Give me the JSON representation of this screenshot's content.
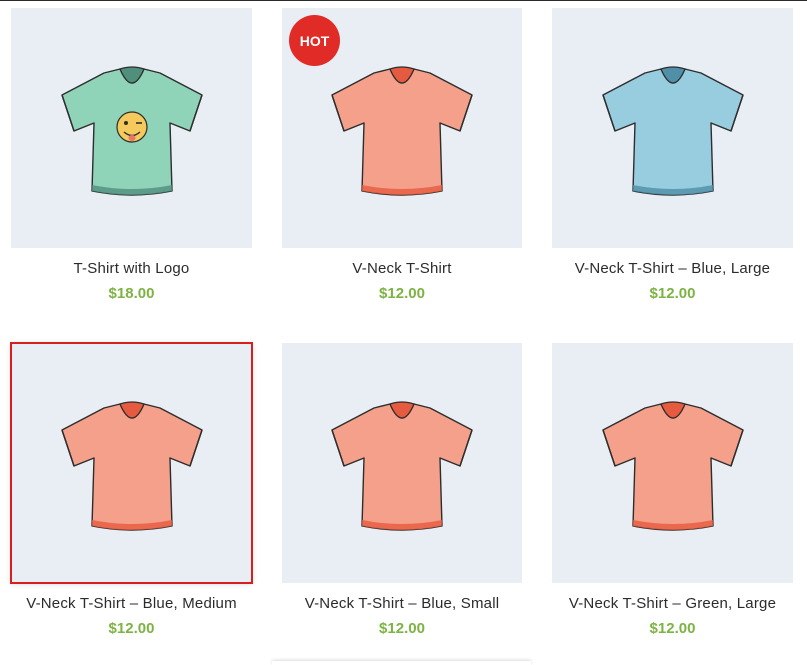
{
  "products": [
    {
      "name": "T-Shirt with Logo",
      "price": "$18.00",
      "color": "#8fd3b8",
      "dark": "#4f8f7c",
      "logo": true,
      "badge": ""
    },
    {
      "name": "V-Neck T-Shirt",
      "price": "$12.00",
      "color": "#f4a08a",
      "dark": "#e65a3f",
      "logo": false,
      "badge": "HOT"
    },
    {
      "name": "V-Neck T-Shirt – Blue, Large",
      "price": "$12.00",
      "color": "#98cde0",
      "dark": "#4f8fa7",
      "logo": false,
      "badge": ""
    },
    {
      "name": "V-Neck T-Shirt – Blue, Medium",
      "price": "$12.00",
      "color": "#f4a08a",
      "dark": "#e65a3f",
      "logo": false,
      "badge": "",
      "selected": true
    },
    {
      "name": "V-Neck T-Shirt – Blue, Small",
      "price": "$12.00",
      "color": "#f4a08a",
      "dark": "#e65a3f",
      "logo": false,
      "badge": ""
    },
    {
      "name": "V-Neck T-Shirt – Green, Large",
      "price": "$12.00",
      "color": "#f4a08a",
      "dark": "#e65a3f",
      "logo": false,
      "badge": ""
    }
  ],
  "colors": {
    "price": "#7cb342",
    "badge": "#e02b27",
    "thumb_bg": "#e8eef3",
    "selection": "#d81f1f"
  }
}
